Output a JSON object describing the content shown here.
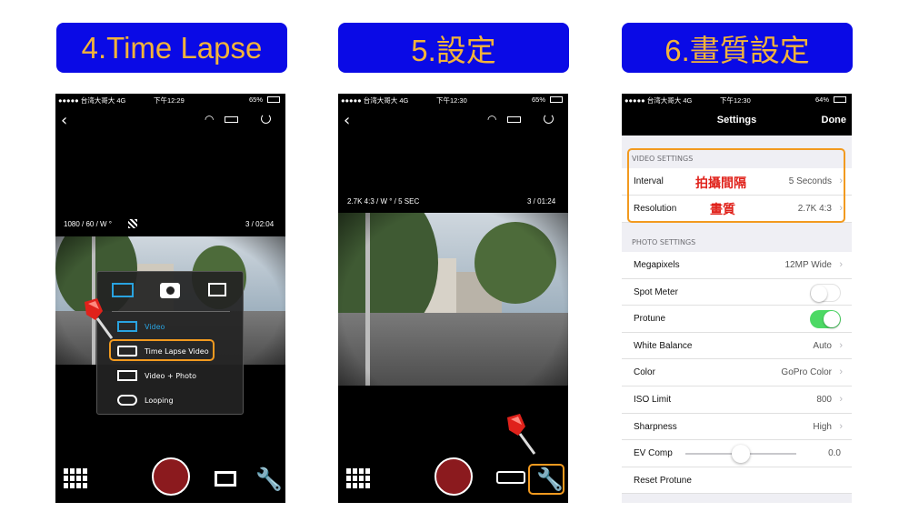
{
  "banners": {
    "time_lapse": "4.Time Lapse",
    "settings": "5.設定",
    "quality": "6.畫質設定"
  },
  "status_bar": {
    "carrier": "●●●●● 台湾大哥大  4G",
    "time_1": "下午12:29",
    "time_2": "下午12:30",
    "time_3": "下午12:30",
    "battery_1": "65%",
    "battery_2": "65%",
    "battery_3": "64%"
  },
  "screen1": {
    "video_mode": "1080 / 60 / W °",
    "counter": "3 / 02:04",
    "menu_items": [
      "Video",
      "Time Lapse Video",
      "Video + Photo",
      "Looping"
    ]
  },
  "screen2": {
    "video_mode": "2.7K 4:3 / W ° / 5 SEC",
    "counter": "3 / 01:24"
  },
  "settings": {
    "title": "Settings",
    "done": "Done",
    "video_section": "VIDEO SETTINGS",
    "photo_section": "PHOTO SETTINGS",
    "video_rows": [
      {
        "label": "Interval",
        "value": "5 Seconds",
        "note": "拍攝間隔"
      },
      {
        "label": "Resolution",
        "value": "2.7K 4:3",
        "note": "畫質"
      }
    ],
    "photo_rows": [
      {
        "label": "Megapixels",
        "value": "12MP Wide"
      },
      {
        "label": "Spot Meter",
        "toggle": false
      },
      {
        "label": "Protune",
        "toggle": true
      },
      {
        "label": "White Balance",
        "value": "Auto"
      },
      {
        "label": "Color",
        "value": "GoPro Color"
      },
      {
        "label": "ISO Limit",
        "value": "800"
      },
      {
        "label": "Sharpness",
        "value": "High"
      },
      {
        "label": "EV Comp",
        "value": "0.0",
        "slider": 0.5
      },
      {
        "label": "Reset Protune"
      }
    ]
  },
  "colors": {
    "banner_bg": "#0a0ae6",
    "banner_text": "#f2b33a",
    "highlight": "#f29a1f",
    "record": "#8b1a1e",
    "accent_blue": "#29a3e0",
    "toggle_on": "#4cd964",
    "annotation_red": "#e0221b"
  }
}
